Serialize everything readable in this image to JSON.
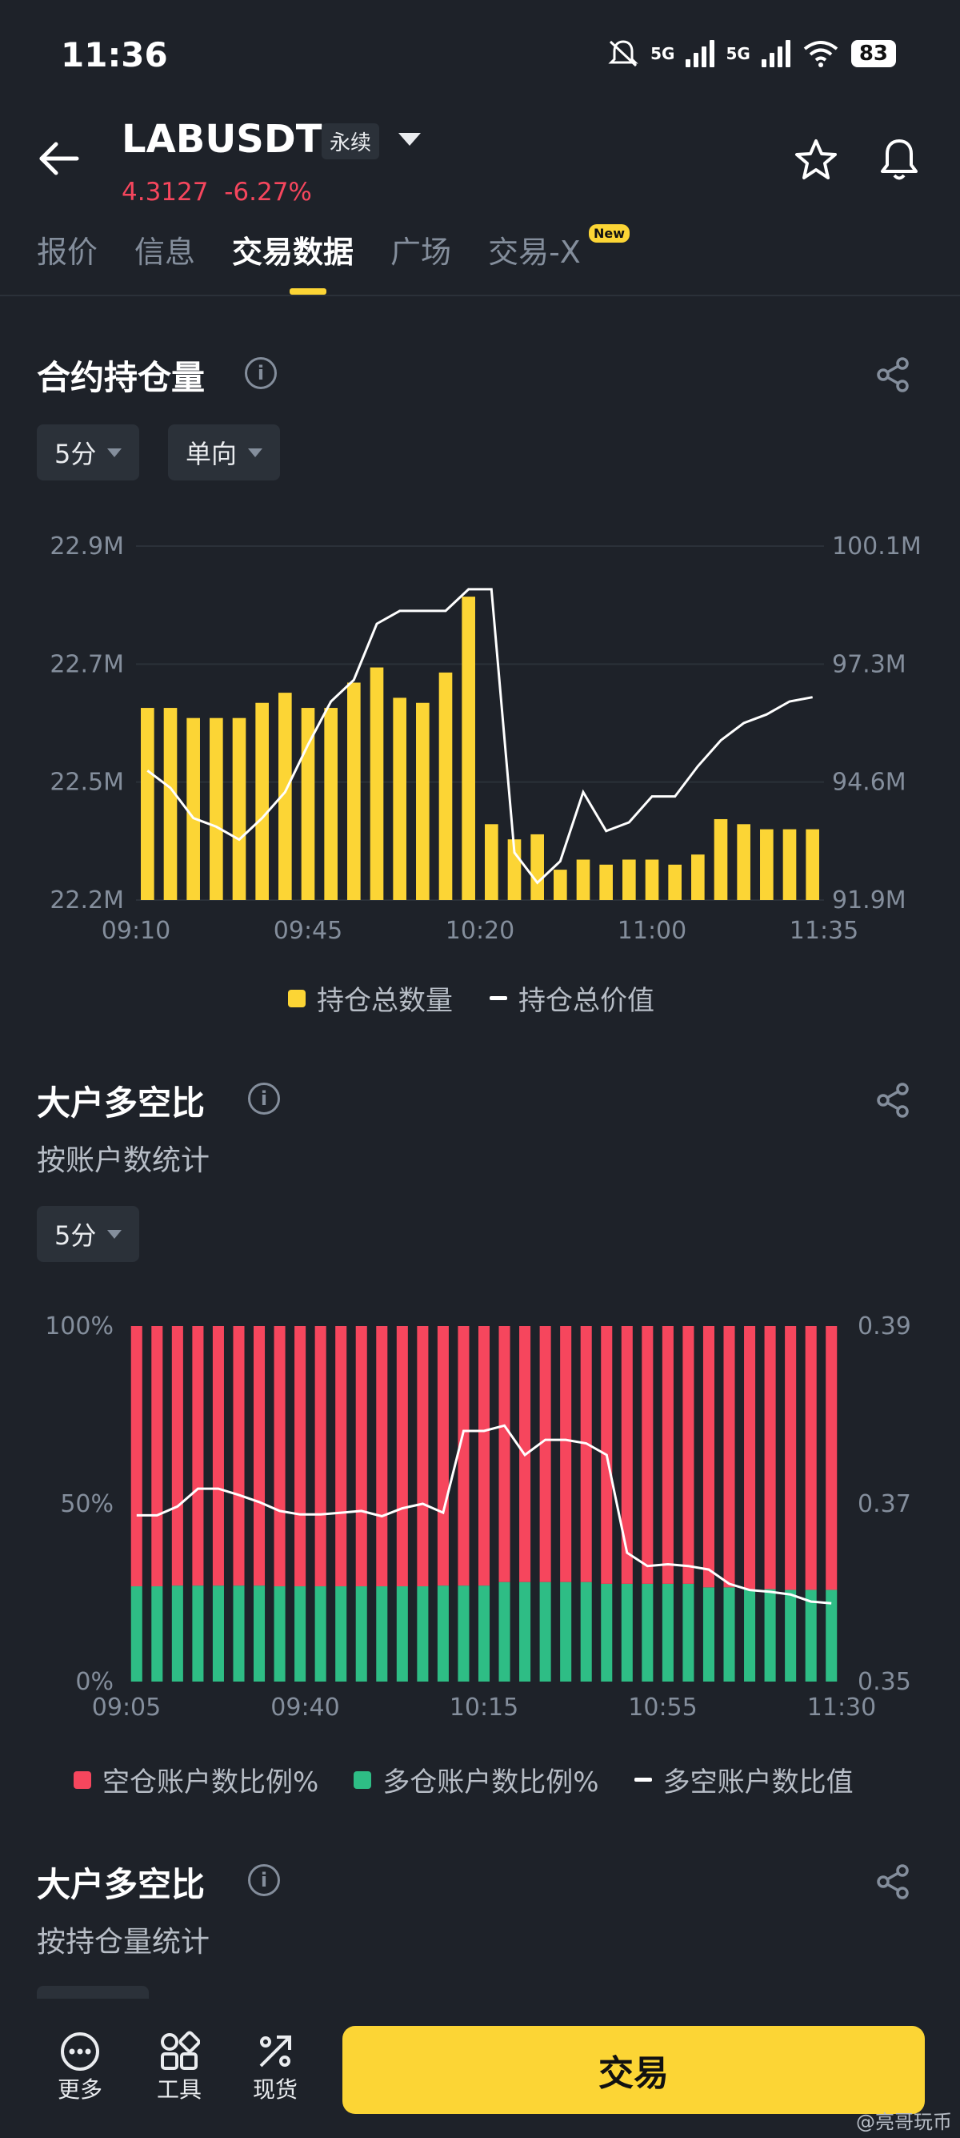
{
  "status": {
    "time": "11:36",
    "net1": "5G",
    "net2": "5G",
    "battery": "83"
  },
  "header": {
    "symbol": "LABUSDT",
    "contract_type": "永续",
    "price": "4.3127",
    "change": "-6.27%"
  },
  "tabs": [
    {
      "label": "报价"
    },
    {
      "label": "信息"
    },
    {
      "label": "交易数据"
    },
    {
      "label": "广场"
    },
    {
      "label": "交易-X"
    }
  ],
  "new_badge": "New",
  "open_interest": {
    "title": "合约持仓量",
    "interval": "5分",
    "direction": "单向",
    "legend_qty": "持仓总数量",
    "legend_value": "持仓总价值"
  },
  "top_ratio_accounts": {
    "title": "大户多空比",
    "subtitle": "按账户数统计",
    "interval": "5分",
    "legend_short": "空仓账户数比例%",
    "legend_long": "多仓账户数比例%",
    "legend_ratio": "多空账户数比值"
  },
  "top_ratio_positions": {
    "title": "大户多空比",
    "subtitle": "按持仓量统计"
  },
  "bottom_nav": {
    "more": "更多",
    "tools": "工具",
    "spot": "现货",
    "trade": "交易"
  },
  "watermark": "@亮哥玩币",
  "colors": {
    "accent": "#fcd535",
    "red": "#f6465d",
    "green": "#2ebd85",
    "bg": "#1e2229"
  },
  "chart_data": [
    {
      "type": "bar",
      "title": "合约持仓量",
      "x_ticks": [
        "09:10",
        "09:45",
        "10:20",
        "11:00",
        "11:35"
      ],
      "y_ticks_left": [
        "22.9M",
        "22.7M",
        "22.5M",
        "22.2M"
      ],
      "y_ticks_right": [
        "100.1M",
        "97.3M",
        "94.6M",
        "91.9M"
      ],
      "ylim": [
        22.2,
        22.9
      ],
      "ylim_right": [
        91.9,
        100.1
      ],
      "series": [
        {
          "name": "持仓总数量",
          "type": "bar",
          "color": "#fcd535",
          "values": [
            22.58,
            22.58,
            22.56,
            22.56,
            22.56,
            22.59,
            22.61,
            22.58,
            22.58,
            22.63,
            22.66,
            22.6,
            22.59,
            22.65,
            22.8,
            22.35,
            22.32,
            22.33,
            22.26,
            22.28,
            22.27,
            22.28,
            22.28,
            22.27,
            22.29,
            22.36,
            22.35,
            22.34,
            22.34,
            22.34
          ]
        },
        {
          "name": "持仓总价值",
          "type": "line",
          "color": "#ffffff",
          "values": [
            94.9,
            94.5,
            93.8,
            93.6,
            93.3,
            93.8,
            94.4,
            95.5,
            96.5,
            97.0,
            98.3,
            98.6,
            98.6,
            98.6,
            99.1,
            99.1,
            93.0,
            92.3,
            92.8,
            94.4,
            93.5,
            93.7,
            94.3,
            94.3,
            95.0,
            95.6,
            96.0,
            96.2,
            96.5,
            96.6
          ]
        }
      ]
    },
    {
      "type": "bar",
      "title": "大户多空比",
      "subtitle": "按账户数统计",
      "x_ticks": [
        "09:05",
        "09:40",
        "10:15",
        "10:55",
        "11:30"
      ],
      "y_ticks_left": [
        "100%",
        "50%",
        "0%"
      ],
      "y_ticks_right": [
        "0.39",
        "0.37",
        "0.35"
      ],
      "ylim": [
        0,
        100
      ],
      "ylim_right": [
        0.35,
        0.39
      ],
      "series": [
        {
          "name": "空仓账户数比例%",
          "type": "stacked-bar",
          "color": "#f6465d",
          "values": [
            73.2,
            73.2,
            73.0,
            73.0,
            73.0,
            73.0,
            73.0,
            73.2,
            73.2,
            73.2,
            73.2,
            73.2,
            73.2,
            73.2,
            73.2,
            73.0,
            73.0,
            73.0,
            72.0,
            72.0,
            72.0,
            72.0,
            72.0,
            72.5,
            72.5,
            72.5,
            72.5,
            72.5,
            73.5,
            73.5,
            74.0,
            74.0,
            74.2,
            74.2,
            74.2
          ]
        },
        {
          "name": "多仓账户数比例%",
          "type": "stacked-bar",
          "color": "#2ebd85",
          "values": [
            26.8,
            26.8,
            27.0,
            27.0,
            27.0,
            27.0,
            27.0,
            26.8,
            26.8,
            26.8,
            26.8,
            26.8,
            26.8,
            26.8,
            26.8,
            27.0,
            27.0,
            27.0,
            28.0,
            28.0,
            28.0,
            28.0,
            28.0,
            27.5,
            27.5,
            27.5,
            27.5,
            27.5,
            26.5,
            26.5,
            26.0,
            26.0,
            25.8,
            25.8,
            25.8
          ]
        },
        {
          "name": "多空账户数比值",
          "type": "line",
          "color": "#ffffff",
          "values": [
            0.3687,
            0.3687,
            0.3697,
            0.3717,
            0.3717,
            0.371,
            0.3702,
            0.3692,
            0.3688,
            0.3688,
            0.369,
            0.3692,
            0.3686,
            0.3695,
            0.37,
            0.369,
            0.3782,
            0.3782,
            0.3788,
            0.3755,
            0.3772,
            0.3772,
            0.3768,
            0.3755,
            0.3645,
            0.363,
            0.3632,
            0.363,
            0.3626,
            0.361,
            0.3603,
            0.3601,
            0.3598,
            0.359,
            0.3588
          ]
        }
      ]
    }
  ]
}
